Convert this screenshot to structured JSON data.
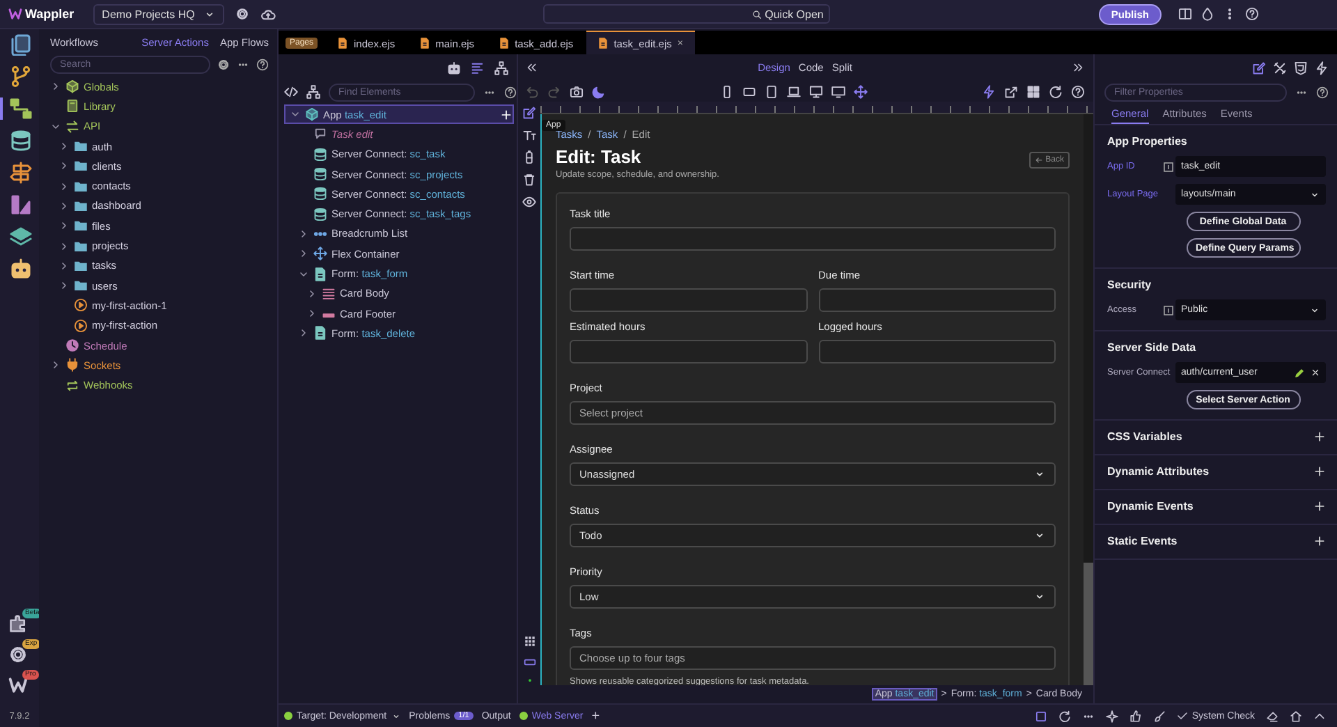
{
  "topbar": {
    "app_name": "Wappler",
    "project": "Demo Projects HQ",
    "quick_open": "Quick Open",
    "publish": "Publish"
  },
  "rail": {
    "items": [
      {
        "selected": false
      },
      {
        "selected": false
      },
      {
        "selected": true
      },
      {
        "selected": false
      },
      {
        "selected": false
      },
      {
        "selected": false
      },
      {
        "selected": false
      },
      {
        "selected": false
      }
    ],
    "bottom": [
      {
        "badge": "Beta",
        "color": "#3aa59a"
      },
      {
        "badge": "Exp",
        "color": "#d9a441"
      },
      {
        "badge": "Pro",
        "color": "#d9534f"
      }
    ],
    "version": "7.9.2"
  },
  "workflows": {
    "title": "Workflows",
    "tabs": [
      {
        "label": "Server Actions",
        "selected": true
      },
      {
        "label": "App Flows",
        "selected": false
      }
    ],
    "search": {
      "placeholder": "Search"
    },
    "tree": [
      {
        "label": "Globals",
        "kind": "cube",
        "color": "#a3c45a",
        "expanded": false
      },
      {
        "label": "Library",
        "kind": "book",
        "color": "#a3c45a"
      },
      {
        "label": "API",
        "kind": "swap",
        "color": "#a3c45a",
        "expanded": true,
        "children": [
          {
            "label": "auth",
            "kind": "folder",
            "color": "#6fb3cc",
            "expanded": false
          },
          {
            "label": "clients",
            "kind": "folder",
            "color": "#6fb3cc",
            "expanded": false
          },
          {
            "label": "contacts",
            "kind": "folder",
            "color": "#6fb3cc",
            "expanded": false
          },
          {
            "label": "dashboard",
            "kind": "folder",
            "color": "#6fb3cc",
            "expanded": false
          },
          {
            "label": "files",
            "kind": "folder",
            "color": "#6fb3cc",
            "expanded": false
          },
          {
            "label": "projects",
            "kind": "folder",
            "color": "#6fb3cc",
            "expanded": false
          },
          {
            "label": "tasks",
            "kind": "folder",
            "color": "#6fb3cc",
            "expanded": false
          },
          {
            "label": "users",
            "kind": "folder",
            "color": "#6fb3cc",
            "expanded": false
          },
          {
            "label": "my-first-action-1",
            "kind": "play",
            "color": "#e8923a"
          },
          {
            "label": "my-first-action",
            "kind": "play",
            "color": "#e8923a"
          }
        ]
      },
      {
        "label": "Schedule",
        "kind": "clock",
        "color": "#c07ab8"
      },
      {
        "label": "Sockets",
        "kind": "plug",
        "color": "#e8923a",
        "expanded": false
      },
      {
        "label": "Webhooks",
        "kind": "loop",
        "color": "#a3c45a"
      }
    ]
  },
  "editor_tabs": {
    "badge": "Pages",
    "tabs": [
      {
        "label": "index.ejs",
        "selected": false
      },
      {
        "label": "main.ejs",
        "selected": false
      },
      {
        "label": "task_add.ejs",
        "selected": false
      },
      {
        "label": "task_edit.ejs",
        "selected": true,
        "close": "×"
      }
    ]
  },
  "structure": {
    "search": {
      "placeholder": "Find Elements"
    },
    "tree": [
      {
        "kind": "cube",
        "type": "App",
        "name": "task_edit",
        "selected": true,
        "expanded": true,
        "children": [
          {
            "kind": "comment",
            "type": "Task edit",
            "selected": false
          },
          {
            "kind": "db",
            "type": "Server Connect:",
            "name": "sc_task",
            "selected": false
          },
          {
            "kind": "db",
            "type": "Server Connect:",
            "name": "sc_projects",
            "selected": false
          },
          {
            "kind": "db",
            "type": "Server Connect:",
            "name": "sc_contacts",
            "selected": false
          },
          {
            "kind": "db",
            "type": "Server Connect:",
            "name": "sc_task_tags",
            "selected": false
          },
          {
            "kind": "dots",
            "type": "Breadcrumb List",
            "selected": false,
            "expanded": false
          },
          {
            "kind": "move",
            "type": "Flex Container",
            "selected": false,
            "expanded": false
          },
          {
            "kind": "doc",
            "type": "Form:",
            "name": "task_form",
            "selected": false,
            "expanded": true,
            "children": [
              {
                "kind": "lines",
                "type": "Card Body",
                "selected": false,
                "expanded": false
              },
              {
                "kind": "bar",
                "type": "Card Footer",
                "selected": false,
                "expanded": false
              }
            ]
          },
          {
            "kind": "doc",
            "type": "Form:",
            "name": "task_delete",
            "selected": false,
            "expanded": false
          }
        ]
      }
    ]
  },
  "canvas": {
    "view_modes": [
      {
        "label": "Design",
        "selected": true
      },
      {
        "label": "Code",
        "selected": false
      },
      {
        "label": "Split",
        "selected": false
      }
    ],
    "tooltip": "App",
    "page": {
      "breadcrumb": [
        "Tasks",
        "Task",
        "Edit"
      ],
      "separator": "/",
      "title": "Edit: Task",
      "subtitle": "Update scope, schedule, and ownership.",
      "back": "Back",
      "form_rows": [
        {
          "fields": [
            {
              "label": "Task title",
              "kind": "input"
            }
          ]
        },
        {
          "fields": [
            {
              "label": "Start time",
              "kind": "input"
            },
            {
              "label": "Due time",
              "kind": "input"
            },
            {
              "label": "Estimated hours",
              "kind": "input"
            },
            {
              "label": "Logged hours",
              "kind": "input"
            }
          ]
        },
        {
          "fields": [
            {
              "label": "Project",
              "kind": "input",
              "placeholder": "Select project"
            }
          ]
        },
        {
          "fields": [
            {
              "label": "Assignee",
              "kind": "select",
              "value": "Unassigned"
            }
          ]
        },
        {
          "fields": [
            {
              "label": "Status",
              "kind": "select",
              "value": "Todo"
            }
          ]
        },
        {
          "fields": [
            {
              "label": "Priority",
              "kind": "select",
              "value": "Low"
            }
          ]
        },
        {
          "fields": [
            {
              "label": "Tags",
              "kind": "input",
              "placeholder": "Choose up to four tags",
              "hint": "Shows reusable categorized suggestions for task metadata."
            }
          ]
        }
      ]
    },
    "path": {
      "separator": ">",
      "items": [
        {
          "type": "App",
          "name": "task_edit",
          "selected": true
        },
        {
          "type": "Form:",
          "name": "task_form",
          "selected": false
        },
        {
          "type": "Card Body",
          "selected": false
        }
      ]
    }
  },
  "properties": {
    "search": {
      "placeholder": "Filter Properties"
    },
    "tabs": [
      {
        "label": "General",
        "selected": true
      },
      {
        "label": "Attributes",
        "selected": false
      },
      {
        "label": "Events",
        "selected": false
      }
    ],
    "sections": [
      {
        "title": "App Properties",
        "expanded": true,
        "rows": [
          {
            "kind": "input",
            "label": "App ID",
            "highlighted": true,
            "bind_icon": true,
            "value": "task_edit"
          },
          {
            "kind": "select",
            "label": "Layout Page",
            "highlighted": true,
            "bind_icon": false,
            "value": "layouts/main"
          },
          {
            "kind": "button",
            "label": "Define Global Data"
          },
          {
            "kind": "button",
            "label": "Define Query Params"
          }
        ]
      },
      {
        "title": "Security",
        "expanded": true,
        "rows": [
          {
            "kind": "select",
            "label": "Access",
            "highlighted": false,
            "bind_icon": true,
            "value": "Public"
          }
        ]
      },
      {
        "title": "Server Side Data",
        "expanded": true,
        "rows": [
          {
            "kind": "edit",
            "label": "Server Connect",
            "highlighted": false,
            "bind_icon": false,
            "value": "auth/current_user"
          },
          {
            "kind": "button",
            "label": "Select Server Action"
          }
        ]
      },
      {
        "title": "CSS Variables",
        "expanded": false
      },
      {
        "title": "Dynamic Attributes",
        "expanded": false
      },
      {
        "title": "Dynamic Events",
        "expanded": false
      },
      {
        "title": "Static Events",
        "expanded": false
      }
    ]
  },
  "status_bar": {
    "target": "Target: Development",
    "problems": "Problems",
    "problems_count": "1/1",
    "output": "Output",
    "server": "Web Server",
    "add": "+",
    "system_check": "System Check"
  }
}
